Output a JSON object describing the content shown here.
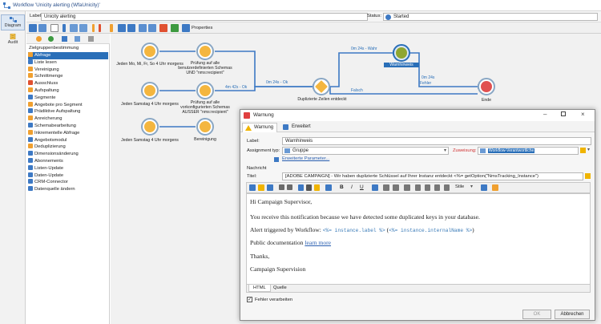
{
  "window": {
    "title": "Workflow 'Unicity alerting (WfaUnicity)'"
  },
  "nav": {
    "items": [
      {
        "label": "Diagram"
      },
      {
        "label": "Audit"
      }
    ]
  },
  "header": {
    "label_caption": "Label:",
    "label_value": "Unicity alerting",
    "status_caption": "Status:",
    "status_value": "Started"
  },
  "toolbar": {
    "properties_label": "Properties"
  },
  "palette": {
    "title": "Zielgruppenbestimmung",
    "items": [
      {
        "label": "Abfrage",
        "color": "#f0a030"
      },
      {
        "label": "Liste lesen",
        "color": "#3d79c4"
      },
      {
        "label": "Vereinigung",
        "color": "#f0a030"
      },
      {
        "label": "Schnittmenge",
        "color": "#f0a030"
      },
      {
        "label": "Ausschluss",
        "color": "#e05030"
      },
      {
        "label": "Aufspaltung",
        "color": "#f0a030"
      },
      {
        "label": "Segmente",
        "color": "#3d79c4"
      },
      {
        "label": "Angebote pro Segment",
        "color": "#f0a030"
      },
      {
        "label": "Prädiktive Aufspaltung",
        "color": "#3d79c4"
      },
      {
        "label": "Anreicherung",
        "color": "#f0a030"
      },
      {
        "label": "Schemabearbeitung",
        "color": "#3d79c4"
      },
      {
        "label": "Inkrementelle Abfrage",
        "color": "#f0a030"
      },
      {
        "label": "Angebotsmodul",
        "color": "#3d79c4"
      },
      {
        "label": "Deduplizierung",
        "color": "#f0a030"
      },
      {
        "label": "Dimensionsänderung",
        "color": "#3d79c4"
      },
      {
        "label": "Abonnements",
        "color": "#3d79c4"
      },
      {
        "label": "Listen-Update",
        "color": "#3d79c4"
      },
      {
        "label": "Daten-Update",
        "color": "#3d79c4"
      },
      {
        "label": "CRM-Connector",
        "color": "#3d79c4"
      },
      {
        "label": "Datenquelle ändern",
        "color": "#3d79c4"
      }
    ]
  },
  "canvas": {
    "nodes": [
      {
        "label": "Jeden Mo, Mi, Fr, So 4 Uhr morgens"
      },
      {
        "label": "Prüfung auf alle benutzerdefinierten Schemas UND \"nms:recipient\""
      },
      {
        "label": "Jeden Samstag 4 Uhr morgens"
      },
      {
        "label": "Prüfung auf alle vorkonfigurierten Schemas AUSSER \"nms:recipient\""
      },
      {
        "label": "Jeden Samstag 4 Uhr morgens"
      },
      {
        "label": "Bereinigung"
      },
      {
        "label": "Duplizierte Zeilen entdeckt"
      },
      {
        "label": "Warnhinweis"
      },
      {
        "label": "Ende"
      }
    ],
    "transitions": [
      {
        "label": "0m 24s - Wahr"
      },
      {
        "label": "0m 24s - Ok"
      },
      {
        "label": "4m 42s - Ok"
      },
      {
        "label": "Falsch"
      },
      {
        "label": "0m 24s"
      },
      {
        "label": "Fehler"
      }
    ]
  },
  "dialog": {
    "title": "Warnung",
    "tabs": [
      {
        "label": "Warnung"
      },
      {
        "label": "Erweitert"
      }
    ],
    "label_caption": "Label:",
    "label_value": "Warnhinweis",
    "assignment_caption": "Assignment typ:",
    "assignment_value": "Gruppe",
    "zuweisung_caption": "Zuweisung:",
    "zuweisung_value": "Workflow-Verantwortliche",
    "advanced_link": "Erweiterte Parameter...",
    "message_caption": "Nachricht",
    "subject_caption": "Titel:",
    "subject_value": "[ADOBE CAMPAIGN] - Wir haben duplizierte Schlüssel auf Ihrer Instanz entdeckt <%= getOption(\"NmsTracking_Instance\")",
    "body": {
      "greeting": "Hi Campaign Supervisor,",
      "line1": "You receive this notification because we have detected some duplicated keys in your database.",
      "line2_prefix": "Alert triggered by Workflow: ",
      "line2_code1": "<%= instance.label %>",
      "line2_mid": " (",
      "line2_code2": "<%= instance.internalName %>",
      "line2_suffix": ")",
      "doc_prefix": "Public documentation ",
      "doc_link": "learn more",
      "thanks": "Thanks,",
      "signature": "Campaign Supervision"
    },
    "style_select": "Stile",
    "editor_tabs": [
      {
        "label": "HTML"
      },
      {
        "label": "Quelle"
      }
    ],
    "process_errors": "Fehler verarbeiten",
    "ok_label": "OK",
    "cancel_label": "Abbrechen"
  }
}
